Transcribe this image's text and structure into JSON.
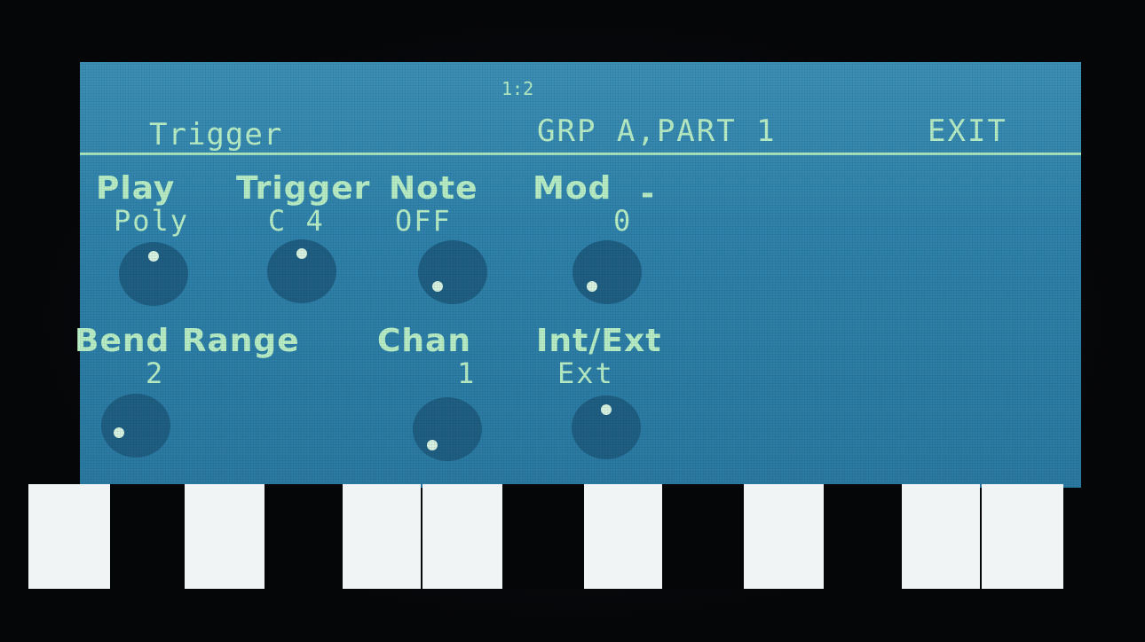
{
  "header": {
    "counter": "1:2",
    "title": "Trigger",
    "group": "GRP A,PART 1",
    "exit_label": "EXIT"
  },
  "row1": [
    {
      "label": "Play",
      "value": "Poly"
    },
    {
      "label": "Trigger",
      "value": "C 4"
    },
    {
      "label": "Note",
      "value": "OFF"
    },
    {
      "label": "Mod",
      "value": "0"
    },
    {
      "label": "-",
      "value": ""
    }
  ],
  "row2": [
    {
      "label": "Bend Range",
      "value": "2"
    },
    {
      "label": "Chan",
      "value": "1"
    },
    {
      "label": "Int/Ext",
      "value": "Ext"
    }
  ],
  "colors": {
    "screen": "#2f82ab",
    "text": "#b8eec6",
    "knob": "#1f5f83",
    "white_key": "#f1f4f5",
    "black_key": "#050608"
  },
  "keyboard": {
    "keys": [
      "white",
      "black",
      "white",
      "black",
      "white",
      "white",
      "black",
      "white",
      "black",
      "white",
      "black",
      "white",
      "white"
    ]
  }
}
